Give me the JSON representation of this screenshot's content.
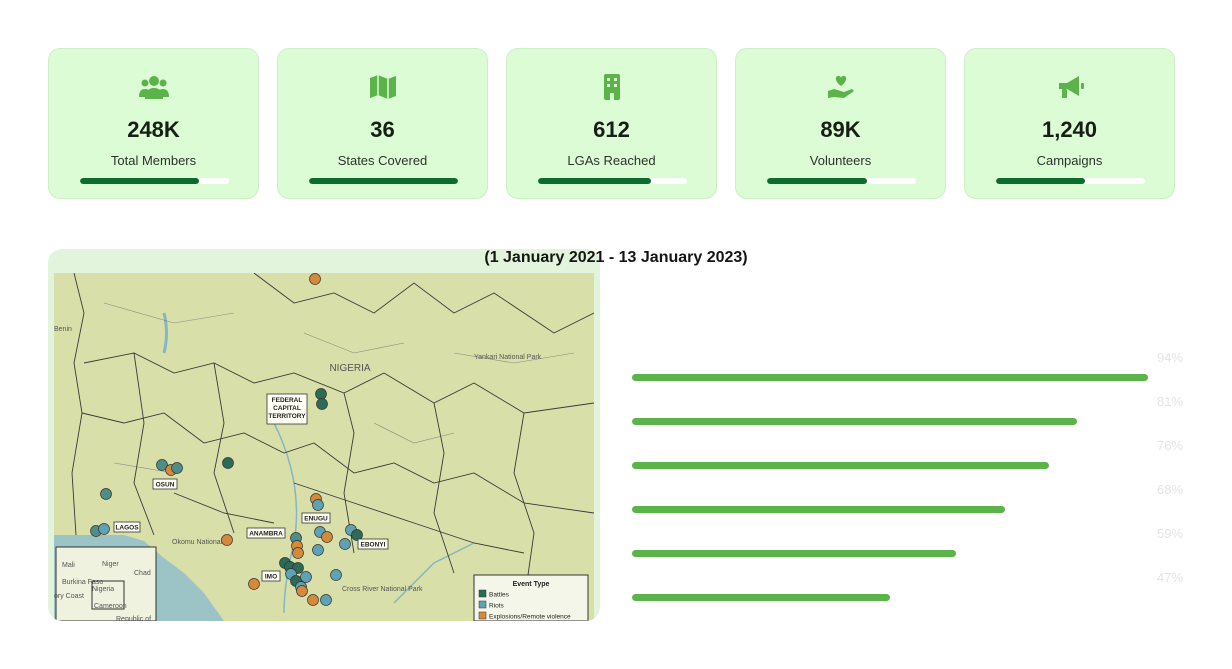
{
  "stats": [
    {
      "icon": "users-icon",
      "value": "248K",
      "label": "Total Members",
      "progress": 0.8
    },
    {
      "icon": "map-icon",
      "value": "36",
      "label": "States Covered",
      "progress": 1.0
    },
    {
      "icon": "building-icon",
      "value": "612",
      "label": "LGAs Reached",
      "progress": 0.76
    },
    {
      "icon": "hand-heart-icon",
      "value": "89K",
      "label": "Volunteers",
      "progress": 0.67
    },
    {
      "icon": "megaphone-icon",
      "value": "1,240",
      "label": "Campaigns",
      "progress": 0.6
    }
  ],
  "colors": {
    "card_bg": "#dcfcd6",
    "progress_fill": "#0d6b2f",
    "bar_fill": "#5cb34a",
    "icon_green": "#5cb34a"
  },
  "map": {
    "title": "(1 January 2021 - 13 January 2023)",
    "country_label": "NIGERIA",
    "region_labels": [
      "FEDERAL CAPITAL TERRITORY",
      "OSUN",
      "LAGOS",
      "ANAMBRA",
      "ENUGU",
      "EBONYI",
      "IMO"
    ],
    "faint_labels": [
      "Yankari National Park",
      "Benin",
      "Niger",
      "Chad",
      "Mali",
      "Burkina Faso",
      "Nigeria",
      "Cameroon",
      "Republic of",
      "ory Coast",
      "Cross River National Park",
      "Okomu National"
    ],
    "legend": {
      "title": "Event Type",
      "items": [
        {
          "label": "Battles",
          "color": "#2d6b57"
        },
        {
          "label": "Riots",
          "color": "#5fa2b4"
        },
        {
          "label": "Explosions/Remote violence",
          "color": "#d58a3a"
        }
      ]
    }
  },
  "bars": [
    {
      "label": "94%",
      "value": 94
    },
    {
      "label": "81%",
      "value": 81
    },
    {
      "label": "76%",
      "value": 76
    },
    {
      "label": "68%",
      "value": 68
    },
    {
      "label": "59%",
      "value": 59
    },
    {
      "label": "47%",
      "value": 47
    }
  ]
}
